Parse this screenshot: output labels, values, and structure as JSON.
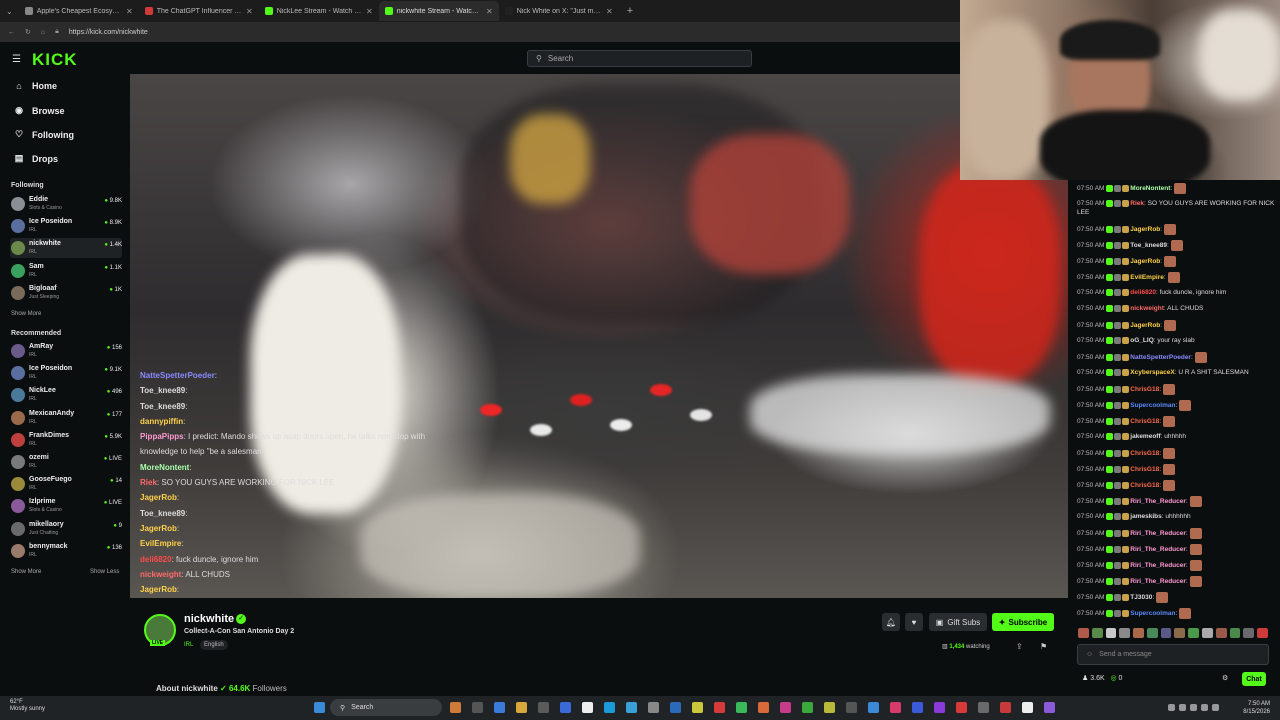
{
  "browser": {
    "tabs": [
      {
        "label": "Apple's Cheapest Ecosystem Broke",
        "fav": "#888888"
      },
      {
        "label": "The ChatGPT Influencer Trip Just F",
        "fav": "#d23a3a"
      },
      {
        "label": "NickLee Stream - Watch Live on Kick",
        "fav": "#53fc18"
      },
      {
        "label": "nickwhite Stream - Watch Live on Kick",
        "fav": "#53fc18"
      },
      {
        "label": "Nick White on X: \"Just made my fi",
        "fav": "#222222"
      }
    ],
    "new_tab": "+",
    "url": "https://kick.com/nickwhite"
  },
  "header": {
    "logo": "KICK",
    "search_placeholder": "Search"
  },
  "sidebar": {
    "nav": [
      {
        "label": "Home",
        "icon": "home-icon",
        "glyph": "⌂"
      },
      {
        "label": "Browse",
        "icon": "browse-icon",
        "glyph": "◉"
      },
      {
        "label": "Following",
        "icon": "heart-icon",
        "glyph": "♡"
      },
      {
        "label": "Drops",
        "icon": "drops-icon",
        "glyph": "▤"
      }
    ],
    "following_title": "Following",
    "following": [
      {
        "name": "Eddie",
        "category": "Slots & Casino",
        "viewers": "9.8K",
        "color": "#8a8f96"
      },
      {
        "name": "Ice Poseidon",
        "category": "IRL",
        "viewers": "8.9K",
        "color": "#5a6fa0"
      },
      {
        "name": "nickwhite",
        "category": "IRL",
        "viewers": "1.4K",
        "color": "#6b8a4a"
      },
      {
        "name": "Sam",
        "category": "IRL",
        "viewers": "1.1K",
        "color": "#3aa060"
      },
      {
        "name": "Bigloaaf",
        "category": "Just Sleeping",
        "viewers": "1K",
        "color": "#7a6a5a"
      }
    ],
    "show_more_1": "Show More",
    "recommended_title": "Recommended",
    "recommended": [
      {
        "name": "AmRay",
        "category": "IRL",
        "viewers": "156",
        "color": "#6a5a8a"
      },
      {
        "name": "Ice Poseidon",
        "category": "IRL",
        "viewers": "9.1K",
        "color": "#5a6fa0"
      },
      {
        "name": "NickLee",
        "category": "IRL",
        "viewers": "496",
        "color": "#4a7a9a"
      },
      {
        "name": "MexicanAndy",
        "category": "IRL",
        "viewers": "177",
        "color": "#9a6a4a"
      },
      {
        "name": "FrankDimes",
        "category": "IRL",
        "viewers": "5.9K",
        "color": "#c04040"
      },
      {
        "name": "ozemi",
        "category": "IRL",
        "viewers": "LIVE",
        "color": "#7a7a7a"
      },
      {
        "name": "GooseFuego",
        "category": "IRL",
        "viewers": "14",
        "color": "#9a8a3a"
      },
      {
        "name": "Izlprime",
        "category": "Slots & Casino",
        "viewers": "LIVE",
        "color": "#8a5a9a"
      },
      {
        "name": "mikellaory",
        "category": "Just Chatting",
        "viewers": "9",
        "color": "#6a6a6a"
      },
      {
        "name": "bennymack",
        "category": "IRL",
        "viewers": "136",
        "color": "#9a7a6a"
      }
    ],
    "show_more_2": "Show More",
    "show_less": "Show Less"
  },
  "overlay_chat": [
    {
      "user": "",
      "text": "",
      "color": "#9a9aff"
    },
    {
      "user": "NatteSpetterPoeder",
      "text": ":",
      "color": "#8a8aff"
    },
    {
      "user": "Toe_knee89",
      "text": ":",
      "color": "#dddddd"
    },
    {
      "user": "Toe_knee89",
      "text": ":",
      "color": "#dddddd"
    },
    {
      "user": "dannypiffin",
      "text": ":",
      "color": "#ffd24a"
    },
    {
      "user": "PippaPipps",
      "text": ": I predict: Mando shows up asap doors open, he talks non-stop with",
      "color": "#ff9ad2"
    },
    {
      "user": "",
      "text": "knowledge to help \"be a salesman\"",
      "color": "#dddddd"
    },
    {
      "user": "MoreNontent",
      "text": ":",
      "color": "#aaffaa"
    },
    {
      "user": "Riek",
      "text": ": SO YOU GUYS ARE WORKING FOR NICK LEE",
      "color": "#ff6a6a"
    },
    {
      "user": "JagerRob",
      "text": ":",
      "color": "#ffd24a"
    },
    {
      "user": "Toe_knee89",
      "text": ":",
      "color": "#dddddd"
    },
    {
      "user": "JagerRob",
      "text": ":",
      "color": "#ffd24a"
    },
    {
      "user": "EvilEmpire",
      "text": ":",
      "color": "#ffd24a"
    },
    {
      "user": "deli6820",
      "text": ": fuck duncle, ignore him",
      "color": "#ff4a4a"
    },
    {
      "user": "nickweight",
      "text": ": ALL CHUDS",
      "color": "#ff6a6a"
    },
    {
      "user": "JagerRob",
      "text": ":",
      "color": "#ffd24a"
    }
  ],
  "stream": {
    "name": "nickwhite",
    "verified": "✓",
    "live": "LIVE",
    "title": "Collect-A-Con San Antonio Day 2",
    "category": "IRL",
    "language": "English",
    "gift_subs": "Gift Subs",
    "subscribe": "Subscribe",
    "watching_count": "1,434",
    "watching_label": "watching",
    "about_label": "About nickwhite",
    "followers_count": "64.6K",
    "followers_label": "Followers"
  },
  "chat": {
    "messages": [
      {
        "time": "07:50 AM",
        "user": "MoreNontent",
        "text": ":",
        "color": "#aaffaa",
        "emote": true
      },
      {
        "time": "07:50 AM",
        "user": "Riek",
        "text": ": SO YOU GUYS ARE WORKING FOR NICK LEE",
        "color": "#ff6a6a",
        "emote": false
      },
      {
        "time": "07:50 AM",
        "user": "JagerRob",
        "text": ":",
        "color": "#ffd24a",
        "emote": true
      },
      {
        "time": "07:50 AM",
        "user": "Toe_knee89",
        "text": ":",
        "color": "#dddddd",
        "emote": true
      },
      {
        "time": "07:50 AM",
        "user": "JagerRob",
        "text": ":",
        "color": "#ffd24a",
        "emote": true
      },
      {
        "time": "07:50 AM",
        "user": "EvilEmpire",
        "text": ":",
        "color": "#ffd24a",
        "emote": true
      },
      {
        "time": "07:50 AM",
        "user": "deli6820",
        "text": ": fuck duncle, ignore him",
        "color": "#ff4a4a",
        "emote": false
      },
      {
        "time": "07:50 AM",
        "user": "nickweight",
        "text": ": ALL CHUDS",
        "color": "#ff6a6a",
        "emote": false
      },
      {
        "time": "07:50 AM",
        "user": "JagerRob",
        "text": ":",
        "color": "#ffd24a",
        "emote": true
      },
      {
        "time": "07:50 AM",
        "user": "oG_LIQ",
        "text": ": your ray slab",
        "color": "#dddddd",
        "emote": false
      },
      {
        "time": "07:50 AM",
        "user": "NatteSpetterPoeder",
        "text": ":",
        "color": "#8a8aff",
        "emote": true
      },
      {
        "time": "07:50 AM",
        "user": "XcyberspaceX",
        "text": ": U R A SHIT SALESMAN",
        "color": "#ffd24a",
        "emote": false
      },
      {
        "time": "07:50 AM",
        "user": "ChrisG18",
        "text": ":",
        "color": "#ff6a4a",
        "emote": true
      },
      {
        "time": "07:50 AM",
        "user": "Supercoolman",
        "text": ":",
        "color": "#5a8aff",
        "emote": true
      },
      {
        "time": "07:50 AM",
        "user": "ChrisG18",
        "text": ":",
        "color": "#ff6a4a",
        "emote": true
      },
      {
        "time": "07:50 AM",
        "user": "jakemeoff",
        "text": ": uhhhhh",
        "color": "#dddddd",
        "emote": false
      },
      {
        "time": "07:50 AM",
        "user": "ChrisG18",
        "text": ":",
        "color": "#ff6a4a",
        "emote": true
      },
      {
        "time": "07:50 AM",
        "user": "ChrisG18",
        "text": ":",
        "color": "#ff6a4a",
        "emote": true
      },
      {
        "time": "07:50 AM",
        "user": "ChrisG18",
        "text": ":",
        "color": "#ff6a4a",
        "emote": true
      },
      {
        "time": "07:50 AM",
        "user": "Riri_The_Reducer",
        "text": ":",
        "color": "#ff9ad2",
        "emote": true
      },
      {
        "time": "07:50 AM",
        "user": "jameskibs",
        "text": ": uhhhhhh",
        "color": "#dddddd",
        "emote": false
      },
      {
        "time": "07:50 AM",
        "user": "Riri_The_Reducer",
        "text": ":",
        "color": "#ff9ad2",
        "emote": true
      },
      {
        "time": "07:50 AM",
        "user": "Riri_The_Reducer",
        "text": ":",
        "color": "#ff9ad2",
        "emote": true
      },
      {
        "time": "07:50 AM",
        "user": "Riri_The_Reducer",
        "text": ":",
        "color": "#ff9ad2",
        "emote": true
      },
      {
        "time": "07:50 AM",
        "user": "Riri_The_Reducer",
        "text": ":",
        "color": "#ff9ad2",
        "emote": true
      },
      {
        "time": "07:50 AM",
        "user": "TJ3030",
        "text": ":",
        "color": "#dddddd",
        "emote": true
      },
      {
        "time": "07:50 AM",
        "user": "Supercoolman",
        "text": ":",
        "color": "#5a8aff",
        "emote": true
      }
    ],
    "input_placeholder": "Send a message",
    "users_count": "3.6K",
    "points": "0",
    "chat_button": "Chat"
  },
  "taskbar": {
    "temp": "62°F",
    "condition": "Mostly sunny",
    "search": "Search",
    "time": "7:50 AM",
    "date": "8/15/2026"
  },
  "colors": {
    "accent": "#53fc18",
    "bg": "#0b0e0f"
  }
}
